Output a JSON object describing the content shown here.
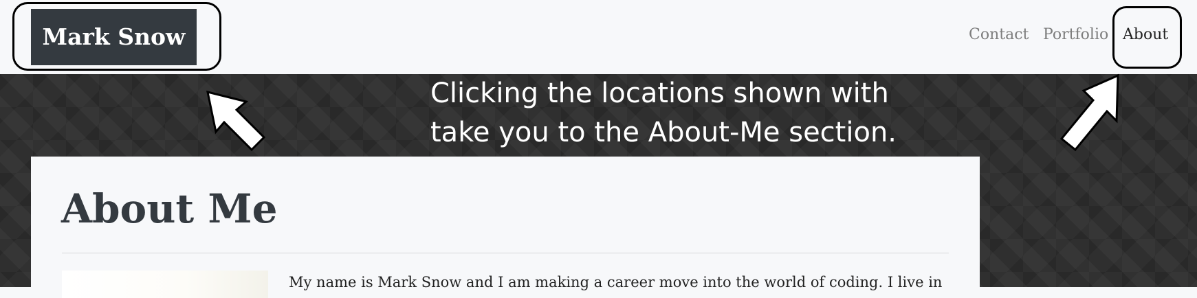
{
  "navbar": {
    "brand": "Mark Snow",
    "links": [
      {
        "label": "Contact"
      },
      {
        "label": "Portfolio"
      },
      {
        "label": "About"
      }
    ]
  },
  "annotation": {
    "line1": "Clicking the locations shown with",
    "line2": "take you to the About-Me section."
  },
  "about": {
    "title": "About Me",
    "bio": "My name is Mark Snow and I am making a career move into the world of coding. I live in"
  },
  "icons": {
    "left_arrow": "arrow-up-left-icon",
    "right_arrow": "arrow-up-right-icon"
  },
  "colors": {
    "brand_bg": "#343a40",
    "page_bg": "#f7f8fa",
    "hero_bg": "#2f2f2f",
    "link_muted": "#7d7d7d"
  }
}
